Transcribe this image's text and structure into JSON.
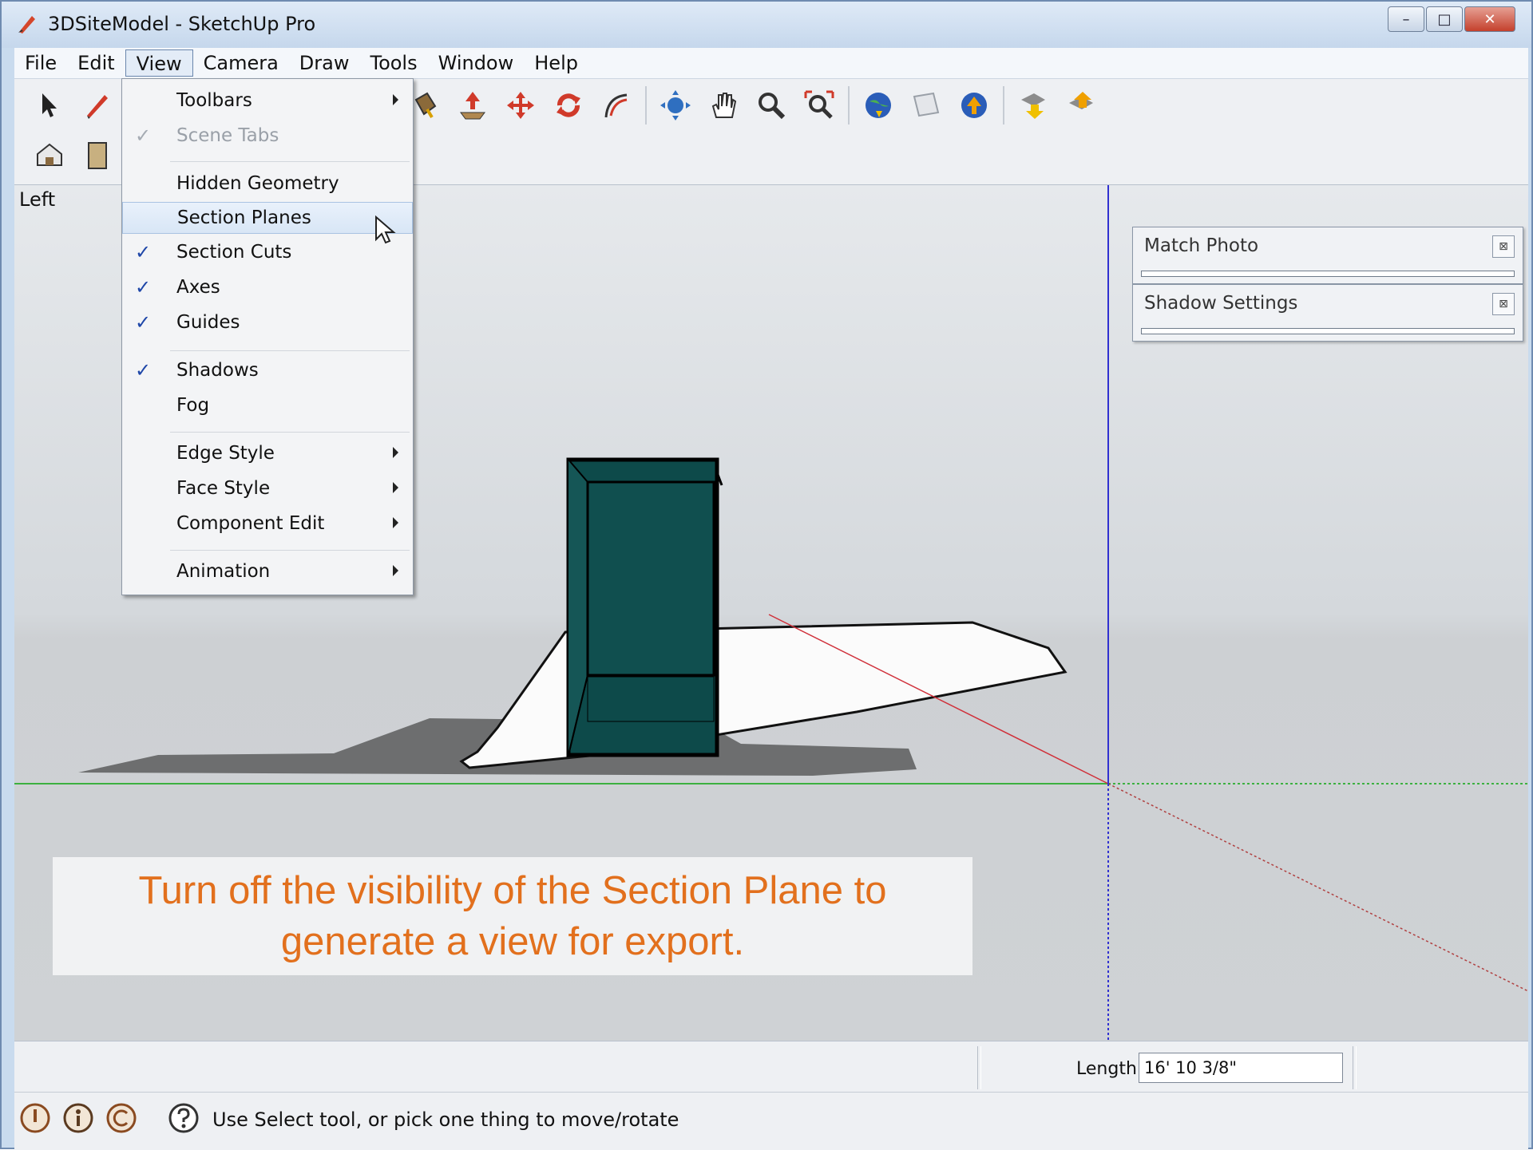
{
  "window": {
    "title": "3DSiteModel - SketchUp Pro",
    "controls": [
      "minimize",
      "maximize",
      "close"
    ]
  },
  "menubar": {
    "items": [
      "File",
      "Edit",
      "View",
      "Camera",
      "Draw",
      "Tools",
      "Window",
      "Help"
    ],
    "active": "View"
  },
  "view_menu": {
    "items": [
      {
        "label": "Toolbars",
        "checked": false,
        "submenu": true
      },
      {
        "label": "Scene Tabs",
        "checked": true,
        "disabled": true
      },
      {
        "label": "Hidden Geometry",
        "checked": false
      },
      {
        "label": "Section Planes",
        "checked": false,
        "highlighted": true
      },
      {
        "label": "Section Cuts",
        "checked": true
      },
      {
        "label": "Axes",
        "checked": true
      },
      {
        "label": "Guides",
        "checked": true
      },
      {
        "label": "Shadows",
        "checked": true
      },
      {
        "label": "Fog",
        "checked": false
      },
      {
        "label": "Edge Style",
        "submenu": true
      },
      {
        "label": "Face Style",
        "submenu": true
      },
      {
        "label": "Component Edit",
        "submenu": true
      },
      {
        "label": "Animation",
        "submenu": true
      }
    ]
  },
  "toolbar": {
    "tools": [
      "select-tool",
      "pencil-tool",
      "paint-bucket-tool",
      "push-pull-tool",
      "move-tool",
      "rotate-tool",
      "follow-me-tool",
      "orbit-tool",
      "pan-tool",
      "zoom-tool",
      "zoom-extents-tool",
      "get-models-tool",
      "share-model-tool",
      "google-earth-tool",
      "get-current-view-tool",
      "toggle-terrain-tool"
    ]
  },
  "viewport": {
    "view_label": "Left",
    "colors": {
      "building": "#0d4a4a",
      "sky": "#e3e6e9",
      "ground": "#cfd2d5",
      "green_axis": "#3cb040",
      "red_axis": "#d0303a",
      "blue_axis": "#3030d0"
    }
  },
  "trays": [
    {
      "title": "Match Photo",
      "close": "⊠"
    },
    {
      "title": "Shadow Settings",
      "close": "⊠"
    }
  ],
  "caption": {
    "line1": "Turn off the visibility of the Section Plane to",
    "line2": "generate a view for export.",
    "color": "#e2701d"
  },
  "measurements": {
    "label": "Length",
    "value": "16' 10 3/8\""
  },
  "statusbar": {
    "icons": [
      "geo-location-icon",
      "credits-icon",
      "copyright-icon",
      "help-icon"
    ],
    "text": "Use Select tool, or pick one thing to move/rotate"
  }
}
